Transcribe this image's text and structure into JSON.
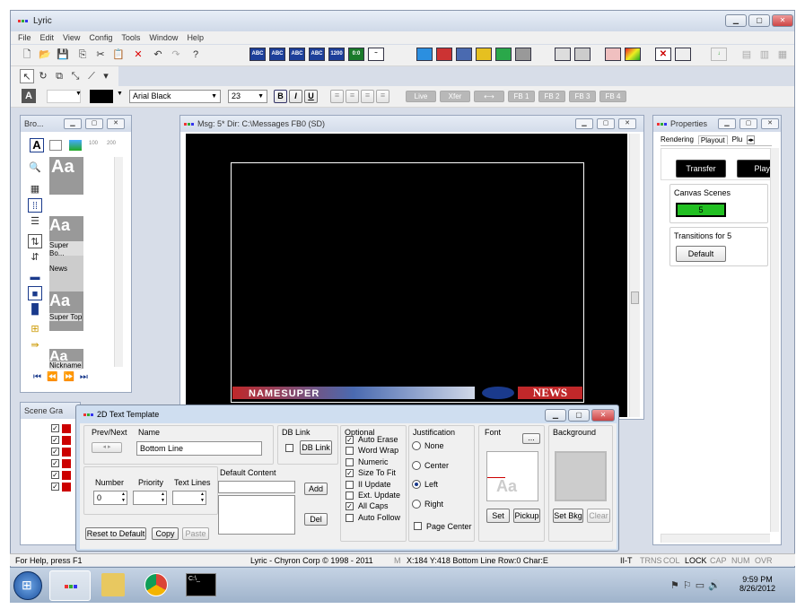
{
  "app": {
    "title": "Lyric"
  },
  "menu": [
    "File",
    "Edit",
    "View",
    "Config",
    "Tools",
    "Window",
    "Help"
  ],
  "format_toolbar": {
    "font": "Arial Black",
    "size": "23",
    "bold": "B",
    "italic": "I",
    "underline": "U",
    "playout": [
      "Live",
      "Xfer",
      "⟷",
      "FB 1",
      "FB 2",
      "FB 3",
      "FB 4"
    ]
  },
  "browser": {
    "title": "Bro...",
    "items": [
      "Super Bo...",
      "News",
      "Super Top",
      "Nickname"
    ]
  },
  "message": {
    "title": "Msg: 5*  Dir: C:\\Messages  FB0 (SD)",
    "banner_left": "NAMESUPER",
    "banner_right": "NEWS"
  },
  "properties": {
    "title": "Properties",
    "tabs": [
      "Rendering",
      "Playout",
      "Plu"
    ],
    "transfer": "Transfer",
    "play": "Play",
    "canvas_scenes_label": "Canvas Scenes",
    "canvas_scenes_value": "5",
    "transitions_label": "Transitions for 5",
    "default_btn": "Default"
  },
  "scene": {
    "title": "Scene Gra"
  },
  "template": {
    "title": "2D Text Template",
    "prevnext_label": "Prev/Next",
    "name_label": "Name",
    "name_value": "Bottom Line",
    "dblink_label": "DB Link",
    "dblink_btn": "DB Link",
    "optional_label": "Optional",
    "options": [
      {
        "label": "Auto Erase",
        "checked": true
      },
      {
        "label": "Word Wrap",
        "checked": false
      },
      {
        "label": "Numeric",
        "checked": false
      },
      {
        "label": "Size To Fit",
        "checked": true
      },
      {
        "label": "II Update",
        "checked": false
      },
      {
        "label": "Ext. Update",
        "checked": false
      },
      {
        "label": "All Caps",
        "checked": true
      },
      {
        "label": "Auto Follow",
        "checked": false
      }
    ],
    "justification_label": "Justification",
    "justify": [
      {
        "label": "None",
        "on": false
      },
      {
        "label": "Center",
        "on": false
      },
      {
        "label": "Left",
        "on": true
      },
      {
        "label": "Right",
        "on": false
      }
    ],
    "page_center": "Page Center",
    "font_label": "Font",
    "font_more": "...",
    "set_btn": "Set",
    "pickup_btn": "Pickup",
    "background_label": "Background",
    "setbkg_btn": "Set Bkg",
    "clear_btn": "Clear",
    "number_label": "Number",
    "number_value": "0",
    "priority_label": "Priority",
    "textlines_label": "Text Lines",
    "default_content_label": "Default Content",
    "add_btn": "Add",
    "del_btn": "Del",
    "reset_btn": "Reset to Default",
    "copy_btn": "Copy",
    "paste_btn": "Paste"
  },
  "status": {
    "help": "For Help, press F1",
    "copyright": "Lyric - Chyron Corp © 1998 - 2011",
    "m": "M",
    "coords": "X:184 Y:418  Bottom Line  Row:0  Char:E",
    "flags": [
      "II-T",
      "TRNS",
      "COL",
      "LOCK",
      "CAP",
      "NUM",
      "OVR"
    ]
  },
  "clock": {
    "time": "9:59 PM",
    "date": "8/26/2012"
  },
  "colors": {
    "titlebar": "#d3dcea",
    "accent": "#1d3f9a",
    "scene_green": "#22c022",
    "banner_red": "#c0282a"
  }
}
